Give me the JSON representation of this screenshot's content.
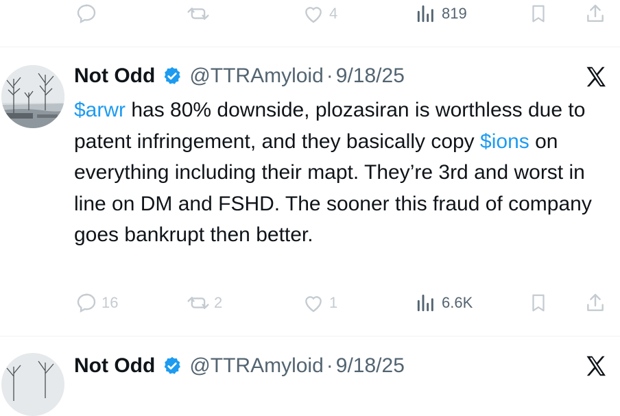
{
  "top_actions": {
    "reply_count": "",
    "repost_count": "",
    "like_count": "4",
    "views_count": "819"
  },
  "tweet": {
    "author_name": "Not Odd",
    "handle": "@TTRAmyloid",
    "separator": "·",
    "date": "9/18/25",
    "text_parts": [
      {
        "text": "$arwr",
        "type": "cashtag"
      },
      {
        "text": " has 80% downside, plozasiran is worthless due to patent infringement, and they basically copy ",
        "type": "text"
      },
      {
        "text": "$ions",
        "type": "cashtag"
      },
      {
        "text": " on everything including their mapt. They’re 3rd and worst in line on DM and FSHD. The sooner this fraud of company goes bankrupt then better.",
        "type": "text"
      }
    ],
    "actions": {
      "reply_count": "16",
      "repost_count": "2",
      "like_count": "1",
      "views_count": "6.6K"
    }
  },
  "next_tweet": {
    "author_name": "Not Odd",
    "handle": "@TTRAmyloid",
    "separator": "·",
    "date": "9/18/25"
  },
  "colors": {
    "accent": "#1d9bf0",
    "verified": "#1d9bf0",
    "muted": "#536471",
    "faint": "#c4cbd1"
  },
  "icons": [
    "reply-icon",
    "repost-icon",
    "like-icon",
    "views-icon",
    "bookmark-icon",
    "share-icon",
    "verified-badge-icon",
    "x-logo-icon"
  ]
}
